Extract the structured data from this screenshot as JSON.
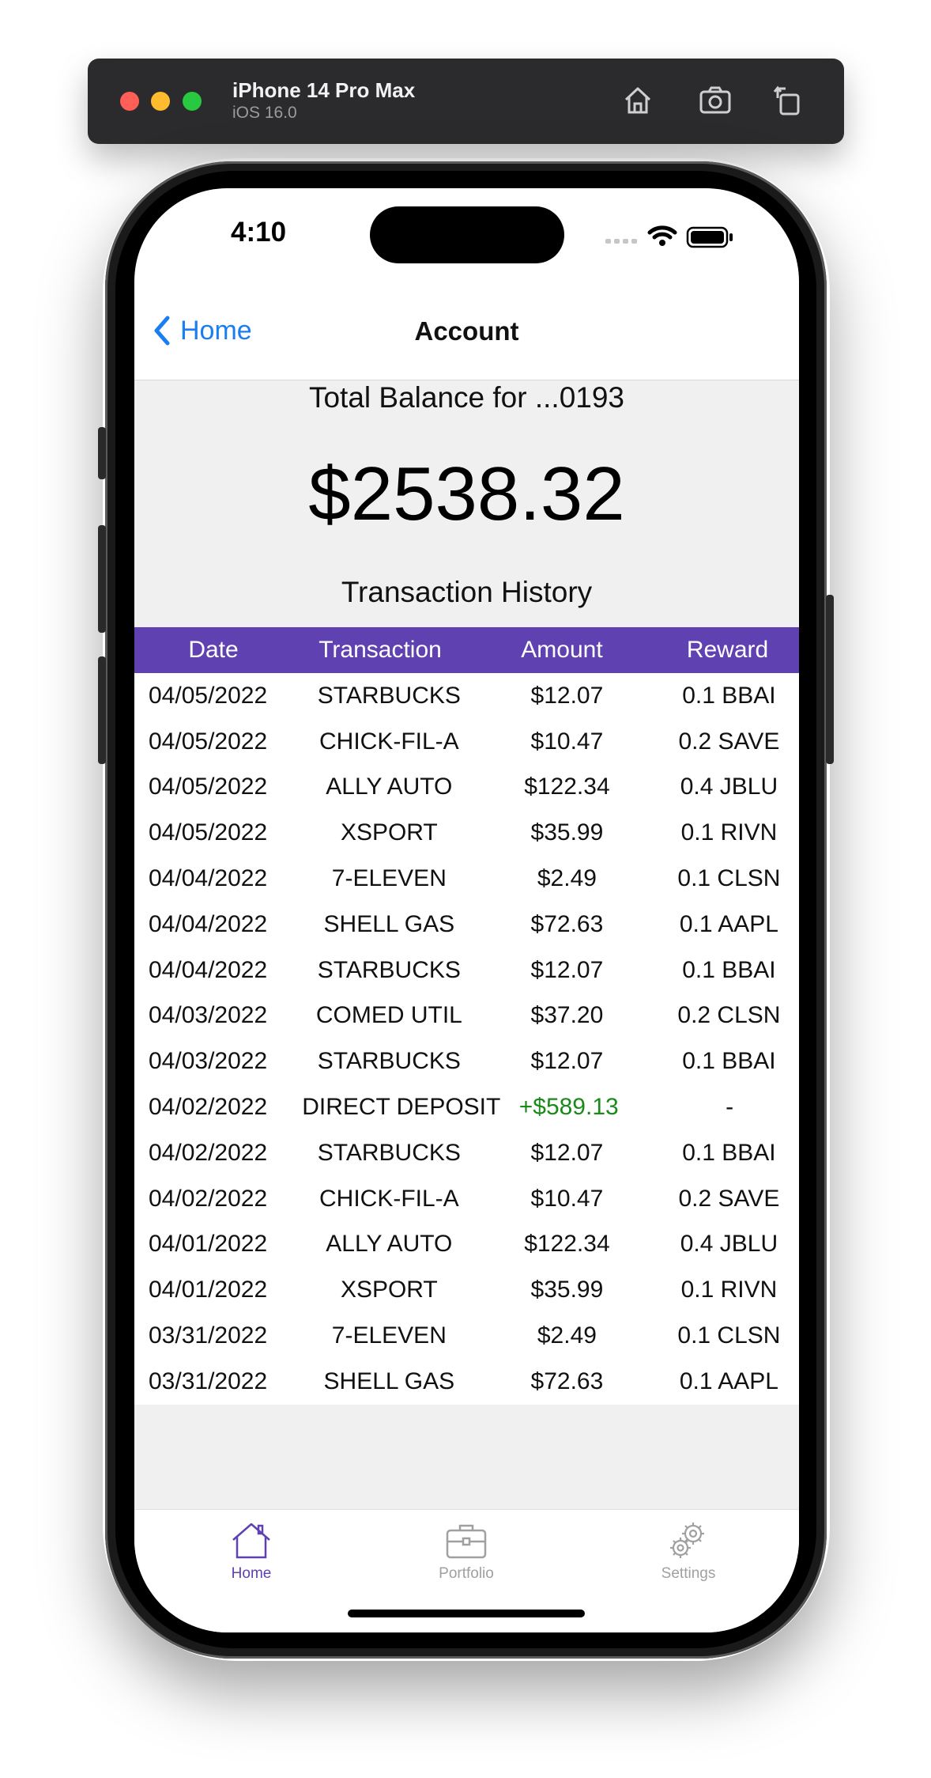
{
  "simulator": {
    "device_name": "iPhone 14 Pro Max",
    "os_version": "iOS 16.0",
    "icons": [
      "home-icon",
      "screenshot-icon",
      "rotate-icon"
    ]
  },
  "status_bar": {
    "time": "4:10"
  },
  "nav": {
    "back_label": "Home",
    "title": "Account"
  },
  "account": {
    "balance_label": "Total Balance for ...0193",
    "balance": "$2538.32",
    "history_title": "Transaction History"
  },
  "table": {
    "headers": [
      "Date",
      "Transaction",
      "Amount",
      "Reward"
    ],
    "rows": [
      {
        "date": "04/05/2022",
        "transaction": "STARBUCKS",
        "amount": "$12.07",
        "reward": "0.1 BBAI"
      },
      {
        "date": "04/05/2022",
        "transaction": "CHICK-FIL-A",
        "amount": "$10.47",
        "reward": "0.2 SAVE"
      },
      {
        "date": "04/05/2022",
        "transaction": "ALLY AUTO",
        "amount": "$122.34",
        "reward": "0.4 JBLU"
      },
      {
        "date": "04/05/2022",
        "transaction": "XSPORT",
        "amount": "$35.99",
        "reward": "0.1 RIVN"
      },
      {
        "date": "04/04/2022",
        "transaction": "7-ELEVEN",
        "amount": "$2.49",
        "reward": "0.1 CLSN"
      },
      {
        "date": "04/04/2022",
        "transaction": "SHELL GAS",
        "amount": "$72.63",
        "reward": "0.1 AAPL"
      },
      {
        "date": "04/04/2022",
        "transaction": "STARBUCKS",
        "amount": "$12.07",
        "reward": "0.1 BBAI"
      },
      {
        "date": "04/03/2022",
        "transaction": "COMED UTIL",
        "amount": "$37.20",
        "reward": "0.2 CLSN"
      },
      {
        "date": "04/03/2022",
        "transaction": "STARBUCKS",
        "amount": "$12.07",
        "reward": "0.1 BBAI"
      },
      {
        "date": "04/02/2022",
        "transaction": "DIRECT DEPOSIT",
        "amount": "+$589.13",
        "reward": "-"
      },
      {
        "date": "04/02/2022",
        "transaction": "STARBUCKS",
        "amount": "$12.07",
        "reward": "0.1 BBAI"
      },
      {
        "date": "04/02/2022",
        "transaction": "CHICK-FIL-A",
        "amount": "$10.47",
        "reward": "0.2 SAVE"
      },
      {
        "date": "04/01/2022",
        "transaction": "ALLY AUTO",
        "amount": "$122.34",
        "reward": "0.4 JBLU"
      },
      {
        "date": "04/01/2022",
        "transaction": "XSPORT",
        "amount": "$35.99",
        "reward": "0.1 RIVN"
      },
      {
        "date": "03/31/2022",
        "transaction": "7-ELEVEN",
        "amount": "$2.49",
        "reward": "0.1 CLSN"
      },
      {
        "date": "03/31/2022",
        "transaction": "SHELL GAS",
        "amount": "$72.63",
        "reward": "0.1 AAPL"
      }
    ]
  },
  "tabbar": {
    "tabs": [
      {
        "label": "Home",
        "icon": "house-icon",
        "active": true
      },
      {
        "label": "Portfolio",
        "icon": "briefcase-icon",
        "active": false
      },
      {
        "label": "Settings",
        "icon": "gear-icon",
        "active": false
      }
    ]
  },
  "colors": {
    "accent": "#6041b1",
    "link": "#1a7df2",
    "positive": "#1a8a1a",
    "tab_inactive": "#a0a0a0"
  }
}
